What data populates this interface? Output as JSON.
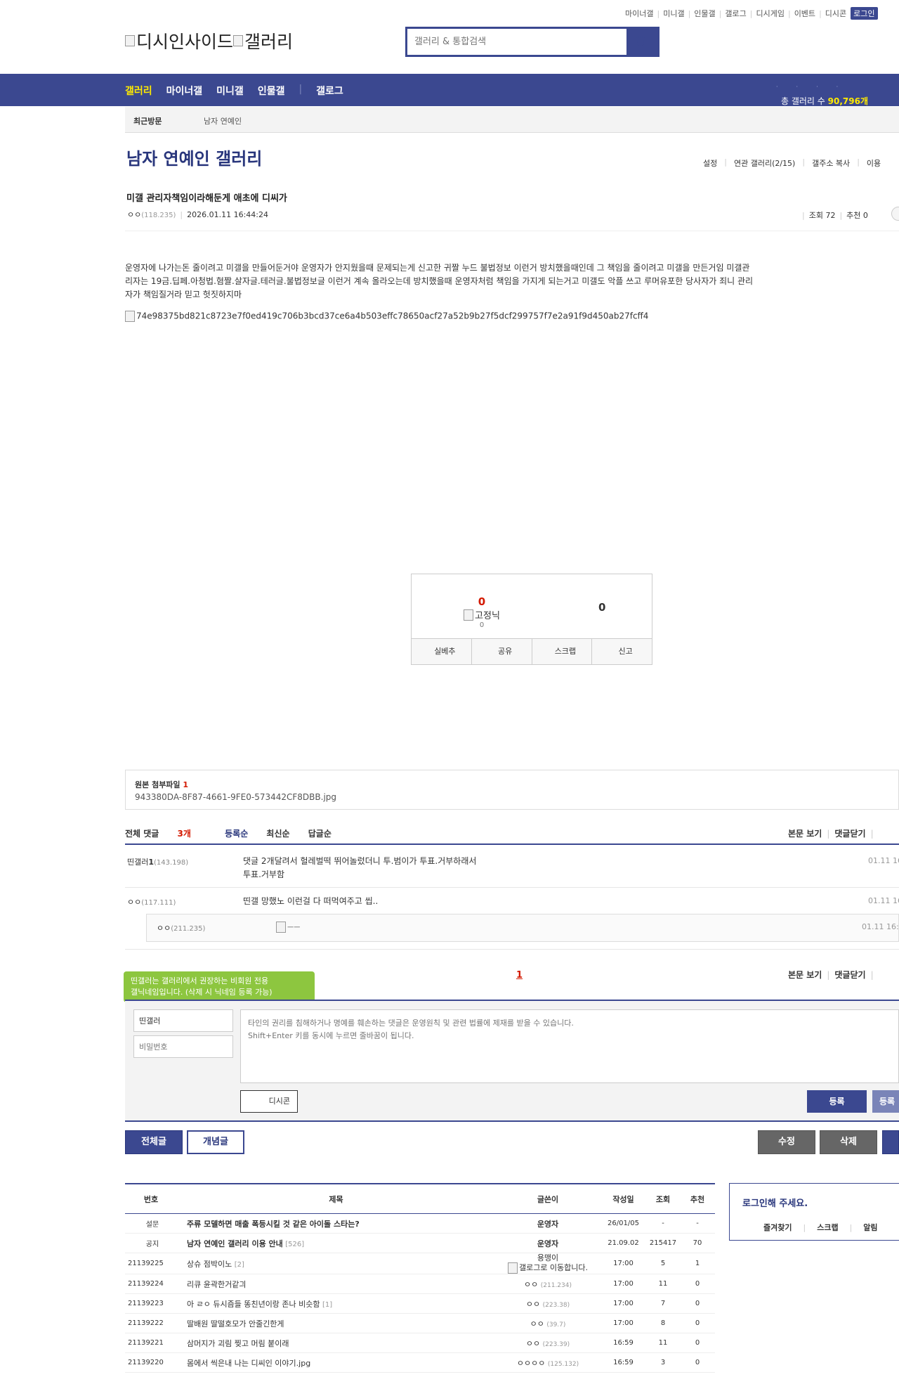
{
  "header": {
    "top_menu": [
      "마이너갤",
      "미니갤",
      "인물갤",
      "갤로그",
      "디시게임",
      "이벤트",
      "디시콘"
    ],
    "login_label": "로그인",
    "logo_alt_1": "디시인사이드",
    "logo_alt_2": "갤러리",
    "search_placeholder": "갤러리 & 통합검색"
  },
  "gnb": {
    "items": [
      "갤러리",
      "마이너갤",
      "미니갤",
      "인물갤",
      "갤로그"
    ],
    "total_label": "총 갤러리 수",
    "total_value": "90,796개"
  },
  "recent_visit": {
    "label": "최근방문",
    "gallery": "남자 연예인"
  },
  "gallery": {
    "title": "남자 연예인 갤러리",
    "options": [
      "설정",
      "연관 갤러리(2/15)",
      "갤주소 복사",
      "이용"
    ]
  },
  "post": {
    "title": "미갤 관리자책임이라해둔게 애초에 디씨가",
    "author": "ㅇㅇ",
    "author_ip": "(118.235)",
    "date": "2026.01.11 16:44:24",
    "views_label": "조회 72",
    "recommend_label": "추천 0",
    "body": "운영자에 나가는돈 줄이려고 미갤을 만들어둔거야 운영자가 안지웠을때 문제되는게 신고한 귀짤 누드 불법정보 이런거 방치했을때인데 그 책임을 줄이려고 미갤을 만든거임 미갤관리자는 19금.딥페.아청법.혐짤.살자글.테러글.불법정보글 이런거 계속 올라오는데 방치했을때 운영자처럼 책임을 가지게 되는거고 미갤도 악플 쓰고 루머유포한 당사자가 죄니 관리자가 책임질거라 믿고 헛짓하지마",
    "image_alt": "74e98375bd821c8723e7f0ed419c706b3bcd37ce6a4b503effc78650acf27a52b9b27f5dcf299757f7e2a91f9d450ab27fcff4"
  },
  "recommend": {
    "up_count": "0",
    "fixed_nick_alt": "고정닉",
    "fixed_count": "0",
    "down_count": "0",
    "buttons": [
      "실베추",
      "공유",
      "스크랩",
      "신고"
    ]
  },
  "attachment": {
    "label": "원본 첨부파일",
    "count": "1",
    "file": "943380DA-8F87-4661-9FE0-573442CF8DBB.jpg"
  },
  "comments": {
    "total_label": "전체 댓글",
    "total_count": "3개",
    "sorts": [
      "등록순",
      "최신순",
      "답글순"
    ],
    "actions": [
      "본문 보기",
      "댓글닫기"
    ],
    "items": [
      {
        "nick": "띤갤러",
        "num": "1",
        "ip": "(143.198)",
        "text": "댓글 2개달려서 헐레벌떡 뛰어놀렀더니 투.범이가 투표.거부하래서",
        "text2": "투표.거부함",
        "date": "01.11 16"
      },
      {
        "nick": "ㅇㅇ",
        "ip": "(117.111)",
        "text": "띤갤 망했노 이런걸 다 떠먹여주고 씹..",
        "date": "01.11 16"
      }
    ],
    "reply": {
      "nick": "ㅇㅇ",
      "ip": "(211.235)",
      "img_alt": "ㅡㅡ",
      "date": "01.11 16:4"
    },
    "page": "1"
  },
  "write": {
    "tooltip_line1": "띤갤러는 갤러리에서 권장하는 비회원 전용",
    "tooltip_line2": "갤닉네임입니다. (삭제 시 닉네임 등록 가능)",
    "nick_value": "띤갤러",
    "pw_placeholder": "비밀번호",
    "textarea_placeholder": "타인의 권리를 침해하거나 명예를 훼손하는 댓글은 운영원칙 및 관련 법률에 제재를 받을 수 있습니다.\nShift+Enter 키를 동시에 누르면 줄바꿈이 됩니다.",
    "dccon_label": "디시콘",
    "submit_label": "등록",
    "submit2_label": "등록"
  },
  "board_buttons": {
    "all": "전체글",
    "concept": "개념글",
    "edit": "수정",
    "delete": "삭제"
  },
  "list": {
    "headers": [
      "번호",
      "제목",
      "글쓴이",
      "작성일",
      "조회",
      "추천"
    ],
    "rows": [
      {
        "num": "설문",
        "title": "주류 모델하면 매출 폭등시킬 것 같은 아이돌 스타는?",
        "cmt": "",
        "writer": "운영자",
        "ip": "",
        "date": "26/01/05",
        "views": "-",
        "rec": "-"
      },
      {
        "num": "공지",
        "title": "남자 연예인 갤러리 이용 안내",
        "cmt": "[526]",
        "writer": "운영자",
        "ip": "",
        "date": "21.09.02",
        "views": "215417",
        "rec": "70"
      },
      {
        "num": "21139225",
        "title": "상슈 점박이노",
        "cmt": "[2]",
        "writer": "용맹이",
        "ip": "",
        "gallog_alt": "갤로그로 이동합니다.",
        "date": "17:00",
        "views": "5",
        "rec": "1"
      },
      {
        "num": "21139224",
        "title": "리큐 윤곽한거같긔",
        "cmt": "",
        "writer": "ㅇㅇ",
        "ip": "(211.234)",
        "date": "17:00",
        "views": "11",
        "rec": "0"
      },
      {
        "num": "21139223",
        "title": "아 ㄹㅇ 듀시즘들 똥친년이랑 존나 비슷함",
        "cmt": "[1]",
        "writer": "ㅇㅇ",
        "ip": "(223.38)",
        "date": "17:00",
        "views": "7",
        "rec": "0"
      },
      {
        "num": "21139222",
        "title": "딸배원 딸떨호모가 안줄긴한게",
        "cmt": "",
        "writer": "ㅇㅇ",
        "ip": "(39.7)",
        "date": "17:00",
        "views": "8",
        "rec": "0"
      },
      {
        "num": "21139221",
        "title": "삼머지가 괴림 찢고 머림 붙이래",
        "cmt": "",
        "writer": "ㅇㅇ",
        "ip": "(223.39)",
        "date": "16:59",
        "views": "11",
        "rec": "0"
      },
      {
        "num": "21139220",
        "title": "몸에서 씩은내 나는 디씨인 이야기.jpg",
        "cmt": "",
        "writer": "ㅇㅇㅇㅇ",
        "ip": "(125.132)",
        "date": "16:59",
        "views": "3",
        "rec": "0"
      }
    ]
  },
  "login_box": {
    "title": "로그인해 주세요.",
    "menu": [
      "즐겨찾기",
      "스크랩",
      "알림"
    ]
  }
}
